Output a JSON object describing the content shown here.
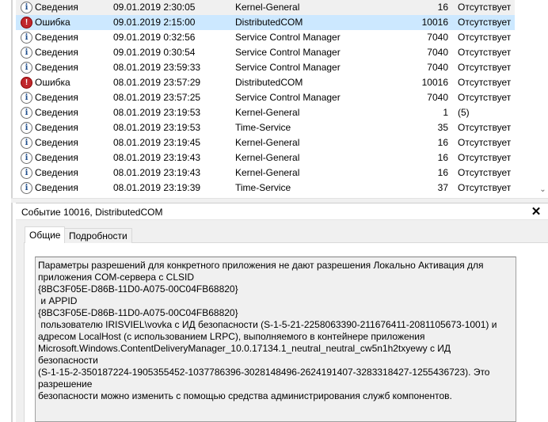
{
  "events": [
    {
      "level": "Сведения",
      "type": "info",
      "date": "09.01.2019 2:30:05",
      "source": "Kernel-General",
      "id": "16",
      "task": "Отсутствует",
      "state": "alt"
    },
    {
      "level": "Ошибка",
      "type": "error",
      "date": "09.01.2019 2:15:00",
      "source": "DistributedCOM",
      "id": "10016",
      "task": "Отсутствует",
      "state": "selected"
    },
    {
      "level": "Сведения",
      "type": "info",
      "date": "09.01.2019 0:32:56",
      "source": "Service Control Manager",
      "id": "7040",
      "task": "Отсутствует",
      "state": ""
    },
    {
      "level": "Сведения",
      "type": "info",
      "date": "09.01.2019 0:30:54",
      "source": "Service Control Manager",
      "id": "7040",
      "task": "Отсутствует",
      "state": ""
    },
    {
      "level": "Сведения",
      "type": "info",
      "date": "08.01.2019 23:59:33",
      "source": "Service Control Manager",
      "id": "7040",
      "task": "Отсутствует",
      "state": ""
    },
    {
      "level": "Ошибка",
      "type": "error",
      "date": "08.01.2019 23:57:29",
      "source": "DistributedCOM",
      "id": "10016",
      "task": "Отсутствует",
      "state": ""
    },
    {
      "level": "Сведения",
      "type": "info",
      "date": "08.01.2019 23:57:25",
      "source": "Service Control Manager",
      "id": "7040",
      "task": "Отсутствует",
      "state": ""
    },
    {
      "level": "Сведения",
      "type": "info",
      "date": "08.01.2019 23:19:53",
      "source": "Kernel-General",
      "id": "1",
      "task": "(5)",
      "state": ""
    },
    {
      "level": "Сведения",
      "type": "info",
      "date": "08.01.2019 23:19:53",
      "source": "Time-Service",
      "id": "35",
      "task": "Отсутствует",
      "state": ""
    },
    {
      "level": "Сведения",
      "type": "info",
      "date": "08.01.2019 23:19:45",
      "source": "Kernel-General",
      "id": "16",
      "task": "Отсутствует",
      "state": ""
    },
    {
      "level": "Сведения",
      "type": "info",
      "date": "08.01.2019 23:19:43",
      "source": "Kernel-General",
      "id": "16",
      "task": "Отсутствует",
      "state": ""
    },
    {
      "level": "Сведения",
      "type": "info",
      "date": "08.01.2019 23:19:43",
      "source": "Kernel-General",
      "id": "16",
      "task": "Отсутствует",
      "state": ""
    },
    {
      "level": "Сведения",
      "type": "info",
      "date": "08.01.2019 23:19:39",
      "source": "Time-Service",
      "id": "37",
      "task": "Отсутствует",
      "state": ""
    }
  ],
  "icons": {
    "info": "info-icon",
    "error": "error-icon",
    "close": "close-icon",
    "scroll_down": "chevron-down-icon"
  },
  "glyphs": {
    "info": "i",
    "error": "!",
    "close": "✕",
    "scroll_down": "⌄"
  },
  "detail": {
    "title": "Событие 10016, DistributedCOM",
    "tabs": {
      "general": "Общие",
      "details": "Подробности"
    },
    "description": "Параметры разрешений для конкретного приложения не дают разрешения Локально Активация для\nприложения COM-сервера с CLSID\n{8BC3F05E-D86B-11D0-A075-00C04FB68820}\n и APPID\n{8BC3F05E-D86B-11D0-A075-00C04FB68820}\n пользователю IRISVIEL\\vovka с ИД безопасности (S-1-5-21-2258063390-211676411-2081105673-1001) и\nадресом LocalHost (с использованием LRPC), выполняемого в контейнере приложения\nMicrosoft.Windows.ContentDeliveryManager_10.0.17134.1_neutral_neutral_cw5n1h2txyewy с ИД безопасности\n(S-1-15-2-350187224-1905355452-1037786396-3028148496-2624191407-3283318427-1255436723). Это разрешение\nбезопасности можно изменить с помощью средства администрирования служб компонентов."
  },
  "colors": {
    "selected_row": "#cce8ff",
    "error_icon": "#c0282d",
    "info_icon": "#1f4e8c"
  }
}
